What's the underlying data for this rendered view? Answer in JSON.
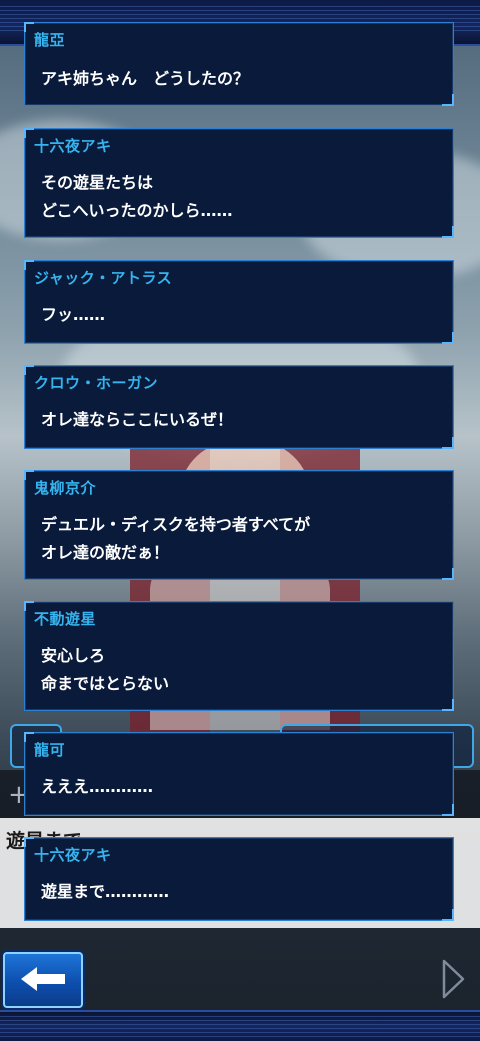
{
  "messages": [
    {
      "speaker": "龍亞",
      "text": "アキ姉ちゃん　どうしたの？"
    },
    {
      "speaker": "十六夜アキ",
      "text": "その遊星たちは\nどこへいったのかしら……"
    },
    {
      "speaker": "ジャック・アトラス",
      "text": "フッ……"
    },
    {
      "speaker": "クロウ・ホーガン",
      "text": "オレ達ならここにいるぜ！"
    },
    {
      "speaker": "鬼柳京介",
      "text": "デュエル・ディスクを持つ者すべてが\nオレ達の敵だぁ！"
    },
    {
      "speaker": "不動遊星",
      "text": "安心しろ\n命まではとらない"
    },
    {
      "speaker": "龍可",
      "text": "えええ…………"
    },
    {
      "speaker": "十六夜アキ",
      "text": "遊星まで…………"
    }
  ],
  "background_text": "遊星まで",
  "icons": {
    "back": "back-arrow-icon",
    "next": "next-triangle-icon"
  },
  "colors": {
    "speaker": "#35b4ef",
    "panel": "#091a3a",
    "border": "#2f7fd0"
  }
}
